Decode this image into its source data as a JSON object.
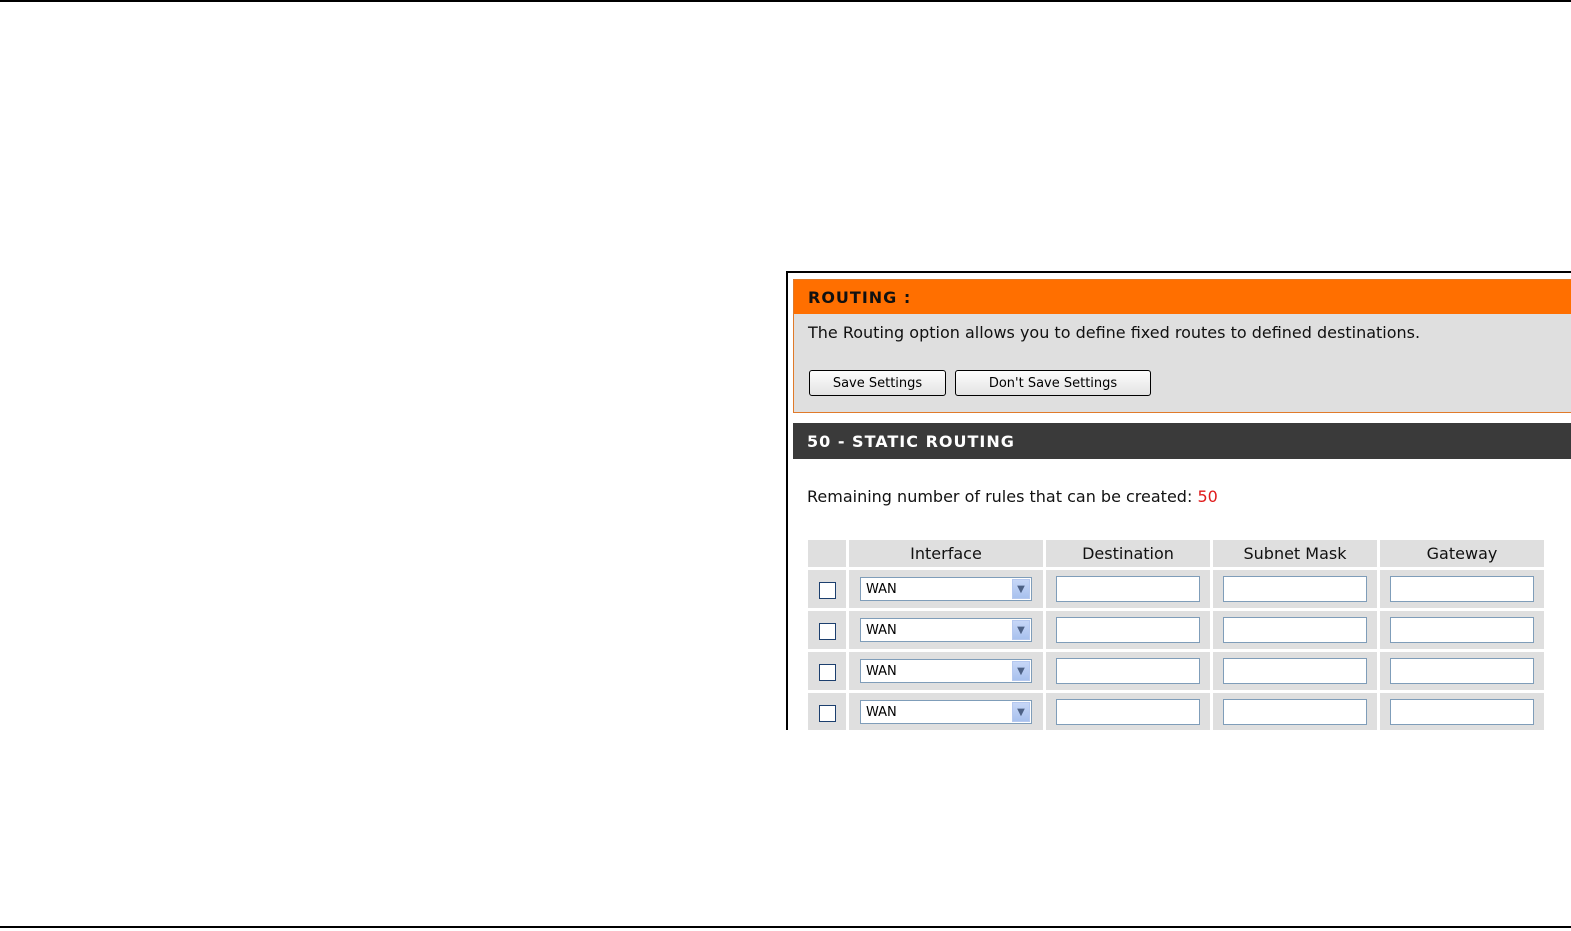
{
  "routing": {
    "title": "ROUTING :",
    "description": "The Routing option allows you to define fixed routes to defined destinations.",
    "save_label": "Save Settings",
    "dont_save_label": "Don't Save Settings",
    "header_color": "#ff6f00"
  },
  "static_routing": {
    "title": "50 - STATIC ROUTING",
    "remaining_label": "Remaining number of rules that can be created:",
    "remaining_count": "50",
    "remaining_color": "#e01b1b",
    "columns": [
      "",
      "Interface",
      "Destination",
      "Subnet Mask",
      "Gateway"
    ],
    "rows": [
      {
        "checked": false,
        "interface": "WAN",
        "destination": "",
        "subnet_mask": "",
        "gateway": ""
      },
      {
        "checked": false,
        "interface": "WAN",
        "destination": "",
        "subnet_mask": "",
        "gateway": ""
      },
      {
        "checked": false,
        "interface": "WAN",
        "destination": "",
        "subnet_mask": "",
        "gateway": ""
      },
      {
        "checked": false,
        "interface": "WAN",
        "destination": "",
        "subnet_mask": "",
        "gateway": ""
      }
    ]
  }
}
